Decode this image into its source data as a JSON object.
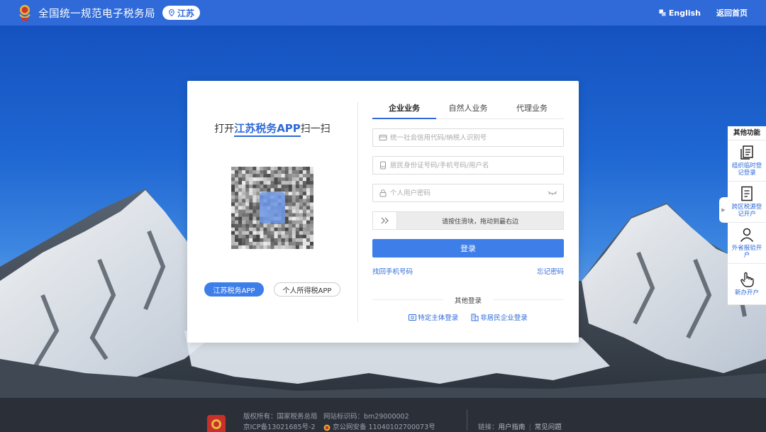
{
  "header": {
    "site_title": "全国统一规范电子税务局",
    "region": "江苏",
    "lang_label": "English",
    "home_label": "返回首页"
  },
  "qr": {
    "title_prefix": "打开",
    "app_name": "江苏税务APP",
    "title_suffix": "扫一扫",
    "app_buttons": [
      "江苏税务APP",
      "个人所得税APP"
    ]
  },
  "tabs": [
    {
      "label": "企业业务",
      "active": true
    },
    {
      "label": "自然人业务",
      "active": false
    },
    {
      "label": "代理业务",
      "active": false
    }
  ],
  "form": {
    "credit_code_placeholder": "统一社会信用代码/纳税人识别号",
    "account_placeholder": "居民身份证号码/手机号码/用户名",
    "password_placeholder": "个人用户密码",
    "slider_text": "请按住滑块，拖动到最右边",
    "login_label": "登录",
    "find_phone_label": "找回手机号码",
    "forgot_password_label": "忘记密码",
    "other_login_label": "其他登录",
    "other_methods": [
      "特定主体登录",
      "非居民企业登录"
    ]
  },
  "side_panel": {
    "title": "其他功能",
    "items": [
      "组织临时登记登录",
      "跨区税源登记开户",
      "外省报验开户",
      "新办开户"
    ]
  },
  "footer": {
    "copyright": "版权所有：国家税务总局",
    "icp": "京ICP备13021685号-2",
    "site_code": "网站标识码：bm29000002",
    "police": "京公网安备 11040102700073号",
    "links_prefix": "链接：",
    "links": [
      "用户指南",
      "常见问题"
    ]
  },
  "colors": {
    "brand": "#2f6ad8",
    "button": "#3d7ee8",
    "footer_bg": "#2a2f38"
  }
}
